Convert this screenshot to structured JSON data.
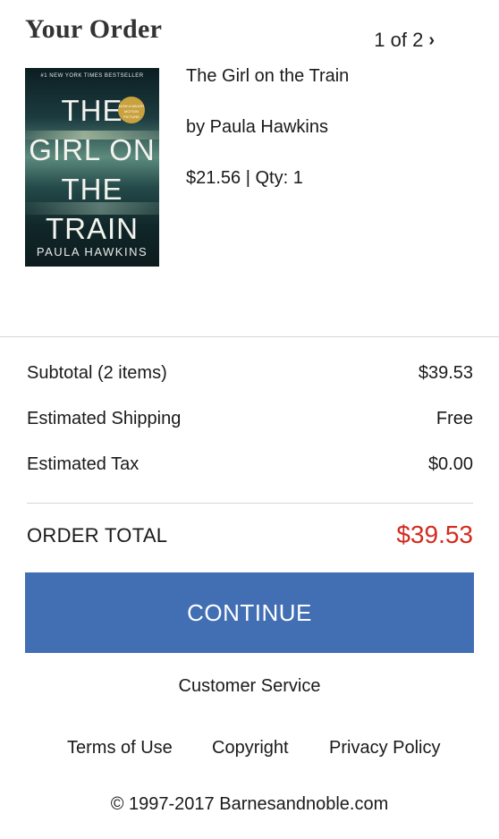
{
  "header": {
    "title": "Your Order",
    "pager_text": "1 of 2",
    "pager_icon": "chevron-right-icon"
  },
  "item": {
    "cover": {
      "tagline": "#1 NEW YORK TIMES BESTSELLER",
      "title_lines": "THE GIRL ON THE TRAIN",
      "seal_text": "NOW A MAJOR MOTION PICTURE",
      "author": "PAULA HAWKINS"
    },
    "title": "The Girl on the Train",
    "author": "by Paula Hawkins",
    "price_qty": "$21.56 | Qty: 1"
  },
  "summary": {
    "subtotal_label": "Subtotal (2 items)",
    "subtotal_value": "$39.53",
    "shipping_label": "Estimated Shipping",
    "shipping_value": "Free",
    "tax_label": "Estimated Tax",
    "tax_value": "$0.00",
    "total_label": "ORDER TOTAL",
    "total_value": "$39.53"
  },
  "actions": {
    "continue_label": "CONTINUE"
  },
  "footer": {
    "customer_service": "Customer Service",
    "terms": "Terms of Use",
    "copyright_link": "Copyright",
    "privacy": "Privacy Policy",
    "copyright_notice": "© 1997-2017 Barnesandnoble.com"
  },
  "colors": {
    "accent_button": "#426eb4",
    "total_price": "#d32b1f",
    "divider": "#d7d7d7"
  }
}
